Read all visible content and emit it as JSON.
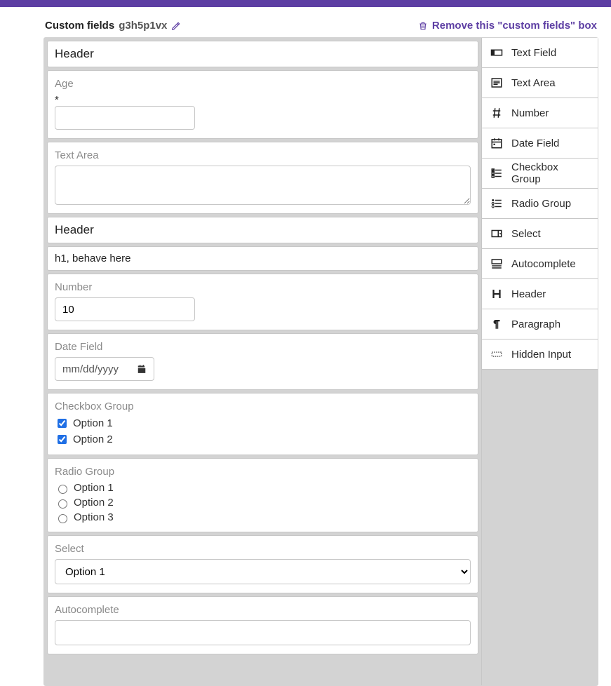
{
  "header": {
    "title": "Custom fields",
    "id": "g3h5p1vx",
    "remove_label": "Remove this \"custom fields\" box"
  },
  "palette": {
    "text_field": "Text Field",
    "text_area": "Text Area",
    "number": "Number",
    "date_field": "Date Field",
    "checkbox_group": "Checkbox Group",
    "radio_group": "Radio Group",
    "select": "Select",
    "autocomplete": "Autocomplete",
    "header": "Header",
    "paragraph": "Paragraph",
    "hidden_input": "Hidden Input"
  },
  "stage": {
    "header1": "Header",
    "age_label": "Age",
    "age_required": "*",
    "age_value": "",
    "textarea_label": "Text Area",
    "textarea_value": "",
    "header2": "Header",
    "paragraph_text": "h1, behave here",
    "number_label": "Number",
    "number_value": "10",
    "date_label": "Date Field",
    "date_placeholder": "mm/dd/yyyy",
    "checkbox_label": "Checkbox Group",
    "checkbox_opt1": "Option 1",
    "checkbox_opt2": "Option 2",
    "radio_label": "Radio Group",
    "radio_opt1": "Option 1",
    "radio_opt2": "Option 2",
    "radio_opt3": "Option 3",
    "select_label": "Select",
    "select_value": "Option 1",
    "autocomplete_label": "Autocomplete",
    "autocomplete_value": ""
  }
}
